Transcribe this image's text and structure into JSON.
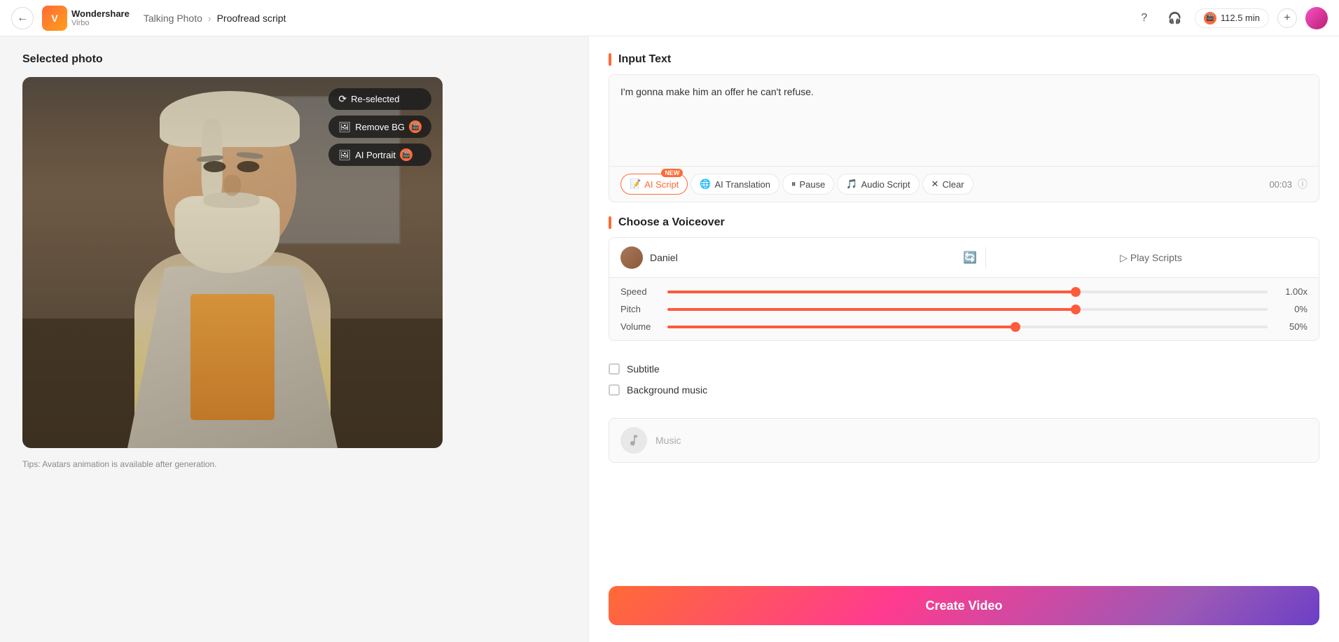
{
  "topbar": {
    "back_label": "←",
    "logo_icon": "V",
    "logo_brand": "Wondershare",
    "logo_product": "Virbo",
    "breadcrumb_parent": "Talking Photo",
    "breadcrumb_arrow": "›",
    "breadcrumb_current": "Proofread script",
    "help_icon": "?",
    "headphone_icon": "🎧",
    "credits_icon": "🎬",
    "credits_value": "112.5 min",
    "add_icon": "+",
    "avatar_initials": ""
  },
  "left_panel": {
    "title": "Selected photo",
    "photo_alt": "Bearded man in suit",
    "overlay_buttons": [
      {
        "icon": "⟳",
        "label": "Re-selected"
      },
      {
        "icon": "🖼",
        "label": "Remove BG",
        "has_badge": true
      },
      {
        "icon": "🖼",
        "label": "AI Portrait",
        "has_badge": true
      }
    ],
    "tips": "Tips: Avatars animation is available after generation."
  },
  "right_panel": {
    "input_section_title": "Input Text",
    "input_text": "I'm gonna make him an offer he can't refuse.",
    "toolbar_buttons": [
      {
        "key": "ai_script",
        "icon": "📝",
        "label": "AI Script",
        "has_new_badge": true
      },
      {
        "key": "ai_translation",
        "icon": "🌐",
        "label": "AI Translation"
      },
      {
        "key": "pause",
        "icon": "⏸",
        "label": "Pause"
      },
      {
        "key": "audio_script",
        "icon": "🎵",
        "label": "Audio Script"
      },
      {
        "key": "clear",
        "icon": "✕",
        "label": "Clear"
      }
    ],
    "time_display": "00:03",
    "info_icon": "ⓘ",
    "voiceover_section_title": "Choose a Voiceover",
    "voice_name": "Daniel",
    "play_scripts_label": "▷ Play Scripts",
    "sliders": [
      {
        "key": "speed",
        "label": "Speed",
        "fill_pct": 68,
        "thumb_pct": 68,
        "value": "1.00x"
      },
      {
        "key": "pitch",
        "label": "Pitch",
        "fill_pct": 68,
        "thumb_pct": 68,
        "value": "0%"
      },
      {
        "key": "volume",
        "label": "Volume",
        "fill_pct": 58,
        "thumb_pct": 58,
        "value": "50%"
      }
    ],
    "checkboxes": [
      {
        "key": "subtitle",
        "label": "Subtitle",
        "checked": false
      },
      {
        "key": "background_music",
        "label": "Background music",
        "checked": false
      }
    ],
    "music_placeholder": "Music",
    "create_video_label": "Create Video"
  }
}
